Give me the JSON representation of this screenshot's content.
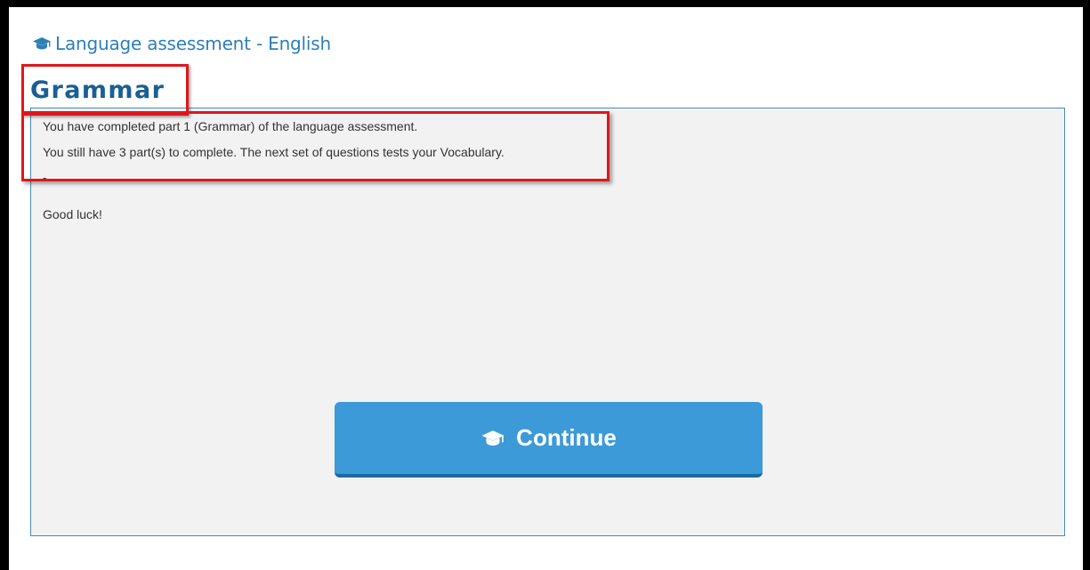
{
  "header": {
    "icon": "graduation-cap-icon",
    "title": "Language assessment - English"
  },
  "page": {
    "title": "Grammar"
  },
  "panel": {
    "message_line1": "You have completed part 1 (Grammar) of the language assessment.",
    "message_line2": "You still have 3 part(s) to complete. The next set of questions tests your Vocabulary.",
    "separator": "-",
    "message_line3": "Good luck!"
  },
  "continue_button": {
    "icon": "graduation-cap-icon",
    "label": "Continue"
  },
  "colors": {
    "accent": "#2d7fb8",
    "title": "#1a5f93",
    "button": "#3d9ad8",
    "highlight": "#e0161c",
    "panel_bg": "#f2f2f2"
  }
}
